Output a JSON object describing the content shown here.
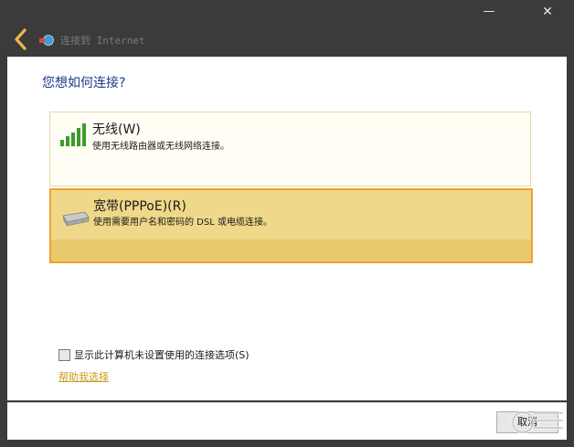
{
  "window": {
    "title": "连接到 Internet",
    "minimize_glyph": "—",
    "close_glyph": "✕",
    "back_icon": "back-arrow-icon",
    "app_icon": "network-globe-icon"
  },
  "main": {
    "heading": "您想如何连接?",
    "options": [
      {
        "title": "无线(W)",
        "description": "使用无线路由器或无线网络连接。",
        "icon": "wireless-signal-icon",
        "selected": false
      },
      {
        "title": "宽带(PPPoE)(R)",
        "description": "使用需要用户名和密码的 DSL 或电缆连接。",
        "icon": "broadband-modem-icon",
        "selected": true
      }
    ],
    "show_unconfigured_label": "显示此计算机未设置使用的连接选项(S)",
    "show_unconfigured_checked": false,
    "help_link": "帮助我选择"
  },
  "footer": {
    "cancel_label": "取消"
  },
  "colors": {
    "titlebar_bg": "#3b3b3b",
    "heading": "#1e3a8c",
    "selected_border": "#f0a030",
    "selected_bg": "#efd889",
    "link": "#c89a18"
  }
}
